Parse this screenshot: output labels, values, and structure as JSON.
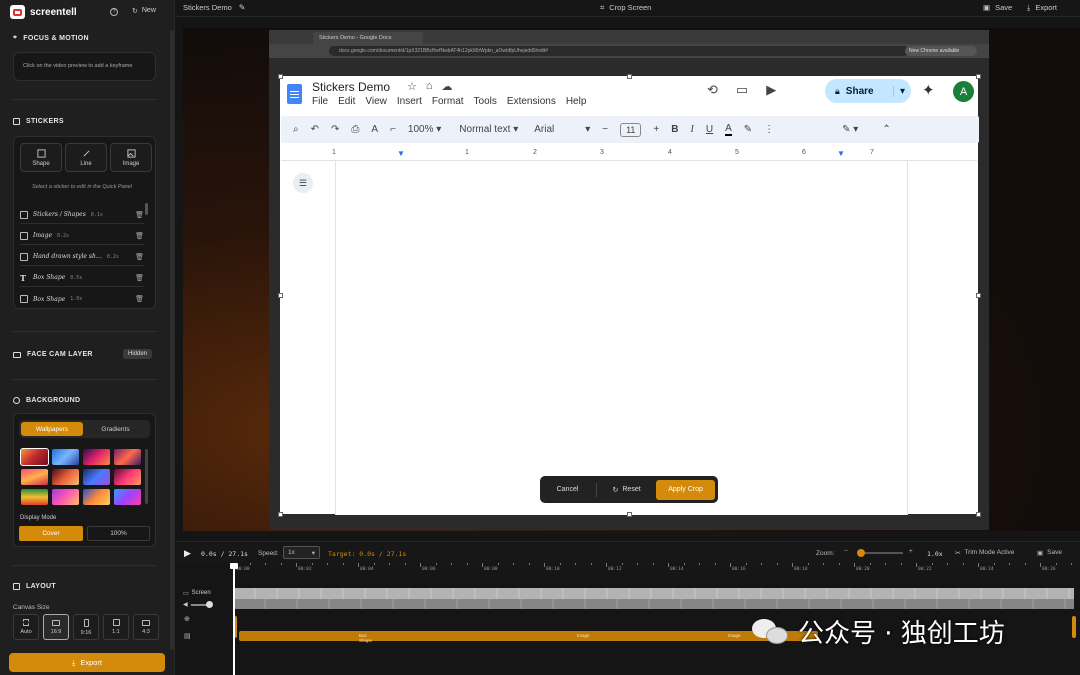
{
  "app": {
    "brand": "screentell",
    "new_label": "New"
  },
  "sidebar": {
    "focus": {
      "title": "FOCUS & MOTION",
      "hint": "Click on the video preview to add a keyframe"
    },
    "stickers": {
      "title": "STICKERS",
      "buttons": [
        "Shape",
        "Line",
        "Image"
      ],
      "hint": "Select a sticker to edit in the Quick Panel",
      "items": [
        {
          "label": "Stickers / Shapes",
          "time": "0.1s"
        },
        {
          "label": "Image",
          "time": "0.2s"
        },
        {
          "label": "Hand drawn style sh…",
          "time": "0.2s"
        },
        {
          "label": "Box Shape",
          "time": "0.5s"
        },
        {
          "label": "Box Shape",
          "time": "1.0s"
        }
      ]
    },
    "facecam": {
      "title": "FACE CAM LAYER",
      "status": "Hidden"
    },
    "background": {
      "title": "BACKGROUND",
      "tabs": [
        "Wallpapers",
        "Gradients"
      ],
      "display_mode_label": "Display Mode",
      "display_modes": [
        "Cover",
        "100%"
      ]
    },
    "layout": {
      "title": "LAYOUT",
      "canvas_size_label": "Canvas Size",
      "sizes": [
        "Auto",
        "16:9",
        "9:16",
        "1:1",
        "4:3"
      ]
    },
    "export_label": "Export"
  },
  "topbar": {
    "project": "Stickers Demo",
    "crop": "Crop Screen",
    "save": "Save",
    "export": "Export"
  },
  "preview": {
    "chrome_tab": "Stickers Demo - Google Docs",
    "chrome_url": "docs.google.com/document/d/1pX321BBcfhefNwbAT4h12pk90rWpkn_aOwIdfpUhejedd9/edit#",
    "chrome_badge": "New Chrome available",
    "doc_title": "Stickers Demo",
    "menu": [
      "File",
      "Edit",
      "View",
      "Insert",
      "Format",
      "Tools",
      "Extensions",
      "Help"
    ],
    "share_label": "Share",
    "avatar": "A",
    "zoom": "100%",
    "style": "Normal text",
    "font": "Arial",
    "font_size": "11",
    "ruler_nums": [
      "1",
      "1",
      "2",
      "3",
      "4",
      "5",
      "6",
      "7"
    ],
    "crop": {
      "cancel": "Cancel",
      "reset": "Reset",
      "apply": "Apply Crop"
    }
  },
  "playback": {
    "time": "0.0s / 27.1s",
    "speed_label": "Speed:",
    "speed_value": "1x",
    "target": "Target: 0.0s / 27.1s",
    "zoom_label": "Zoom:",
    "zoom_value": "1.0x",
    "trim_label": "Trim Mode Active",
    "save_label": "Save",
    "zoom_level": 0.05
  },
  "timeline": {
    "ruler": [
      "00:00",
      "00:02",
      "00:04",
      "00:06",
      "00:08",
      "00:10",
      "00:12",
      "00:14",
      "00:16",
      "00:18",
      "00:20",
      "00:22",
      "00:24",
      "00:26"
    ],
    "track_label": "Screen",
    "clip_labels": [
      "Box Shape",
      "Image",
      "Image"
    ]
  },
  "watermark": "公众号 · 独创工坊",
  "colors": {
    "accent": "#d48a0a",
    "docs_blue": "#1a73e8",
    "share_bg": "#c2e7ff",
    "avatar": "#188038"
  }
}
